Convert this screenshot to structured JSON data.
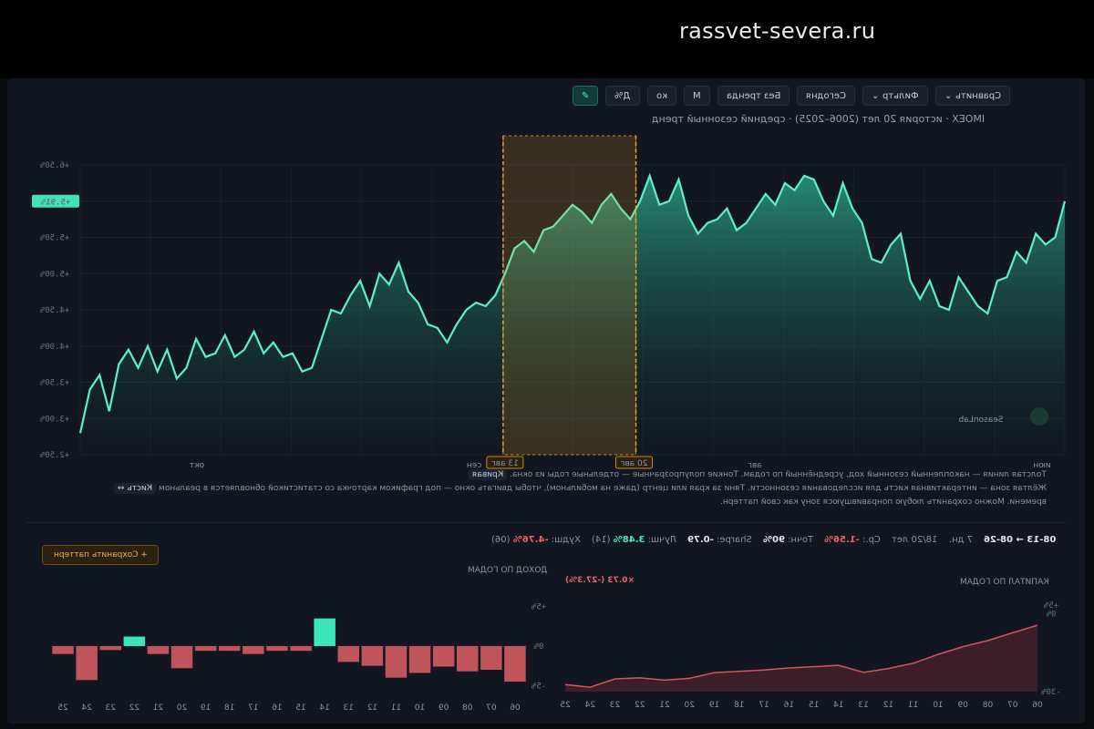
{
  "site": {
    "domain": "rassvet-severa.ru"
  },
  "toolbar": {
    "buttons": [
      {
        "label": "Д%",
        "active": false
      },
      {
        "label": "ко",
        "active": false
      },
      {
        "label": "М",
        "active": false
      },
      {
        "label": "Без тренда",
        "active": false
      },
      {
        "label": "Сегодня",
        "active": false
      },
      {
        "label": "Фильтр",
        "active": false
      },
      {
        "label": "Сравнить",
        "active": false
      }
    ],
    "active_tool_icon": "pencil-icon"
  },
  "header": {
    "subtitle": "IMOEX · история 20 лет (2006–2025) · средний сезонный тренд"
  },
  "main_chart": {
    "brand": "SeasonLab",
    "current_value_badge": "+5.91%",
    "y_ticks": [
      "+2.50%",
      "+3.00%",
      "+3.50%",
      "+4.00%",
      "+4.50%",
      "+5.00%",
      "+5.50%",
      "+6.00%",
      "+6.50%"
    ],
    "x_ticks": [
      "июн",
      "авг",
      "сен",
      "окт"
    ],
    "selection_start_label": "20 авг",
    "selection_end_label": "13 авг",
    "colors": {
      "line": "#5cf0c6",
      "selection": "#e8a020",
      "bg": "#121620"
    }
  },
  "chart_data": {
    "type": "line",
    "title": "IMOEX · история 20 лет (2006–2025) · средний сезонный тренд",
    "ylim": [
      2.5,
      6.5
    ],
    "y_unit": "%",
    "values": [
      2.8,
      3.4,
      3.6,
      3.1,
      3.75,
      3.95,
      3.7,
      4.0,
      3.65,
      3.95,
      3.55,
      3.7,
      4.1,
      3.85,
      3.9,
      4.15,
      3.85,
      3.95,
      4.2,
      3.9,
      4.05,
      3.85,
      3.9,
      3.65,
      3.7,
      4.1,
      4.5,
      4.45,
      4.7,
      4.9,
      4.55,
      5.0,
      4.85,
      5.15,
      4.75,
      4.6,
      4.3,
      4.25,
      4.05,
      4.3,
      4.5,
      4.6,
      4.55,
      4.7,
      5.0,
      5.35,
      5.45,
      5.3,
      5.6,
      5.65,
      5.8,
      5.95,
      5.85,
      5.7,
      5.95,
      6.1,
      5.9,
      5.75,
      6.0,
      6.35,
      5.95,
      6.0,
      6.3,
      5.8,
      5.55,
      5.7,
      5.75,
      5.9,
      5.6,
      5.7,
      5.9,
      6.1,
      5.95,
      6.25,
      6.15,
      6.35,
      6.3,
      6.0,
      5.8,
      6.25,
      5.9,
      5.7,
      5.2,
      5.15,
      5.4,
      5.55,
      4.9,
      4.65,
      4.9,
      4.55,
      4.5,
      4.95,
      4.75,
      4.55,
      4.45,
      4.9,
      4.95,
      5.3,
      5.15,
      5.55,
      5.4,
      5.5,
      6.0
    ],
    "selection_range_index": [
      44,
      57
    ]
  },
  "notes": {
    "line1_key": "Кривая",
    "line1": "Толстая линия — накопленный сезонный ход, усреднённый по годам. Тонкие полупрозрачные — отдельные годы из окна.",
    "line2_key": "Кисть ↔",
    "line2": "Жёлтая зона — интерактивная кисть для исследования сезонности. Тяни за края или центр (даже на мобильном), чтобы двигать окно — под графиком карточка со статистикой обновляется в реальном",
    "line3": "времени. Можно сохранить любую понравившуюся зону как свой паттерн."
  },
  "stats": {
    "range": "08-13 → 08-26",
    "days": "7 дн.",
    "years": "18/20 лет",
    "avg_label": "Ср.:",
    "avg_value": "-1.56%",
    "accuracy_label": "Точн:",
    "accuracy_value": "90%",
    "sharpe_label": "Sharpe:",
    "sharpe_value": "-0.79",
    "best_label": "Лучш:",
    "best_value": "3.48%",
    "best_year": "(14)",
    "worst_label": "Худш:",
    "worst_value": "-4.76%",
    "worst_year": "(06)",
    "save_button": "+ Сохранить паттерн"
  },
  "bottom_left": {
    "title": "ДОХОД ПО ГОДАМ",
    "y_ticks": [
      "+5%",
      "0%",
      "-5%"
    ],
    "colors": {
      "pos": "#3ff0c2",
      "neg": "#c9595f"
    }
  },
  "bottom_right": {
    "title": "КАПИТАЛ ПО ГОДАМ",
    "badge": "×0.73 (-27.3%)",
    "y_ticks": [
      "+5%",
      "0%",
      "-30%"
    ]
  },
  "bars_chart": {
    "type": "bar",
    "categories": [
      "06",
      "07",
      "08",
      "09",
      "10",
      "11",
      "12",
      "13",
      "14",
      "15",
      "16",
      "17",
      "18",
      "19",
      "20",
      "21",
      "22",
      "23",
      "24",
      "25"
    ],
    "values": [
      -4.5,
      -3.0,
      -3.2,
      -2.6,
      -3.4,
      -4.0,
      -2.5,
      -2.0,
      3.5,
      -0.6,
      -0.6,
      -1.0,
      -0.6,
      -0.6,
      -2.8,
      -1.0,
      1.2,
      -0.5,
      -4.3,
      -1.0
    ],
    "ylim": [
      -6,
      6
    ]
  },
  "capital_chart": {
    "type": "area",
    "categories": [
      "06",
      "07",
      "08",
      "09",
      "10",
      "11",
      "12",
      "13",
      "14",
      "15",
      "16",
      "17",
      "18",
      "19",
      "20",
      "21",
      "22",
      "23",
      "24",
      "25"
    ],
    "values": [
      -4.5,
      -7.4,
      -10.4,
      -12.7,
      -15.7,
      -19.1,
      -21.1,
      -22.6,
      -19.9,
      -20.4,
      -20.9,
      -21.7,
      -22.2,
      -22.7,
      -24.9,
      -25.6,
      -24.7,
      -25.1,
      -28.3,
      -27.3
    ],
    "ylim": [
      -30,
      5
    ]
  }
}
